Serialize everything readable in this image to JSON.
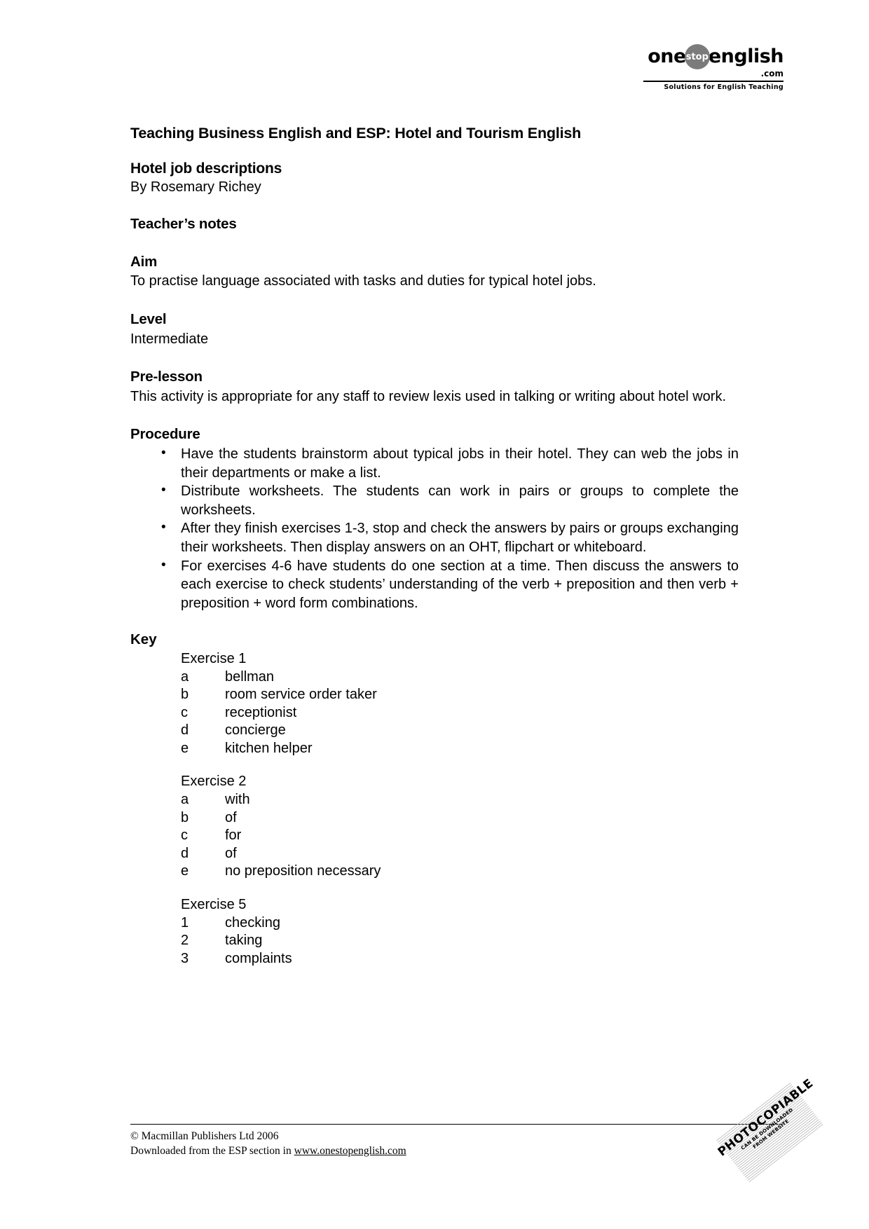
{
  "logo": {
    "word_one": "one",
    "badge": "stop",
    "word_english": "english",
    "dotcom": ".com",
    "tagline": "Solutions for English Teaching"
  },
  "header": {
    "title": "Teaching Business English and ESP: Hotel and Tourism English"
  },
  "lesson": {
    "title": "Hotel job descriptions",
    "author": "By Rosemary Richey",
    "notes_heading": "Teacher’s notes"
  },
  "sections": {
    "aim": {
      "heading": "Aim",
      "text": "To practise language associated with tasks and duties for typical hotel jobs."
    },
    "level": {
      "heading": "Level",
      "text": "Intermediate"
    },
    "pre_lesson": {
      "heading": "Pre-lesson",
      "text": "This activity is appropriate for any staff to review lexis used in talking or writing about hotel work."
    },
    "procedure": {
      "heading": "Procedure",
      "bullets": [
        "Have the students brainstorm about typical jobs in their hotel. They can web the jobs in their departments or make a list.",
        "Distribute worksheets. The students can work in pairs or groups to complete the worksheets.",
        "After they finish exercises 1-3, stop and check the answers by pairs or groups exchanging their worksheets. Then display answers on an OHT, flipchart or whiteboard.",
        "For exercises 4-6 have students do one section at a time. Then discuss the answers to each exercise to check students’ understanding of the verb + preposition and then verb + preposition + word form combinations."
      ]
    },
    "key": {
      "heading": "Key",
      "exercises": [
        {
          "title": "Exercise 1",
          "answers": [
            {
              "label": "a",
              "text": "bellman"
            },
            {
              "label": "b",
              "text": "room service order taker"
            },
            {
              "label": "c",
              "text": "receptionist"
            },
            {
              "label": "d",
              "text": "concierge"
            },
            {
              "label": "e",
              "text": "kitchen helper"
            }
          ]
        },
        {
          "title": "Exercise 2",
          "answers": [
            {
              "label": "a",
              "text": "with"
            },
            {
              "label": "b",
              "text": "of"
            },
            {
              "label": "c",
              "text": "for"
            },
            {
              "label": "d",
              "text": "of"
            },
            {
              "label": "e",
              "text": "no preposition necessary"
            }
          ]
        },
        {
          "title": "Exercise 5",
          "answers": [
            {
              "label": "1",
              "text": "checking"
            },
            {
              "label": "2",
              "text": "taking"
            },
            {
              "label": "3",
              "text": "complaints"
            }
          ]
        }
      ]
    }
  },
  "footer": {
    "copyright": "© Macmillan Publishers Ltd 2006",
    "downloaded_prefix": "Downloaded from the ESP section in ",
    "url": "www.onestopenglish.com"
  },
  "stamp": {
    "main": "PHOTOCOPIABLE",
    "line1": "CAN BE DOWNLOADED",
    "line2": "FROM WEBSITE"
  }
}
